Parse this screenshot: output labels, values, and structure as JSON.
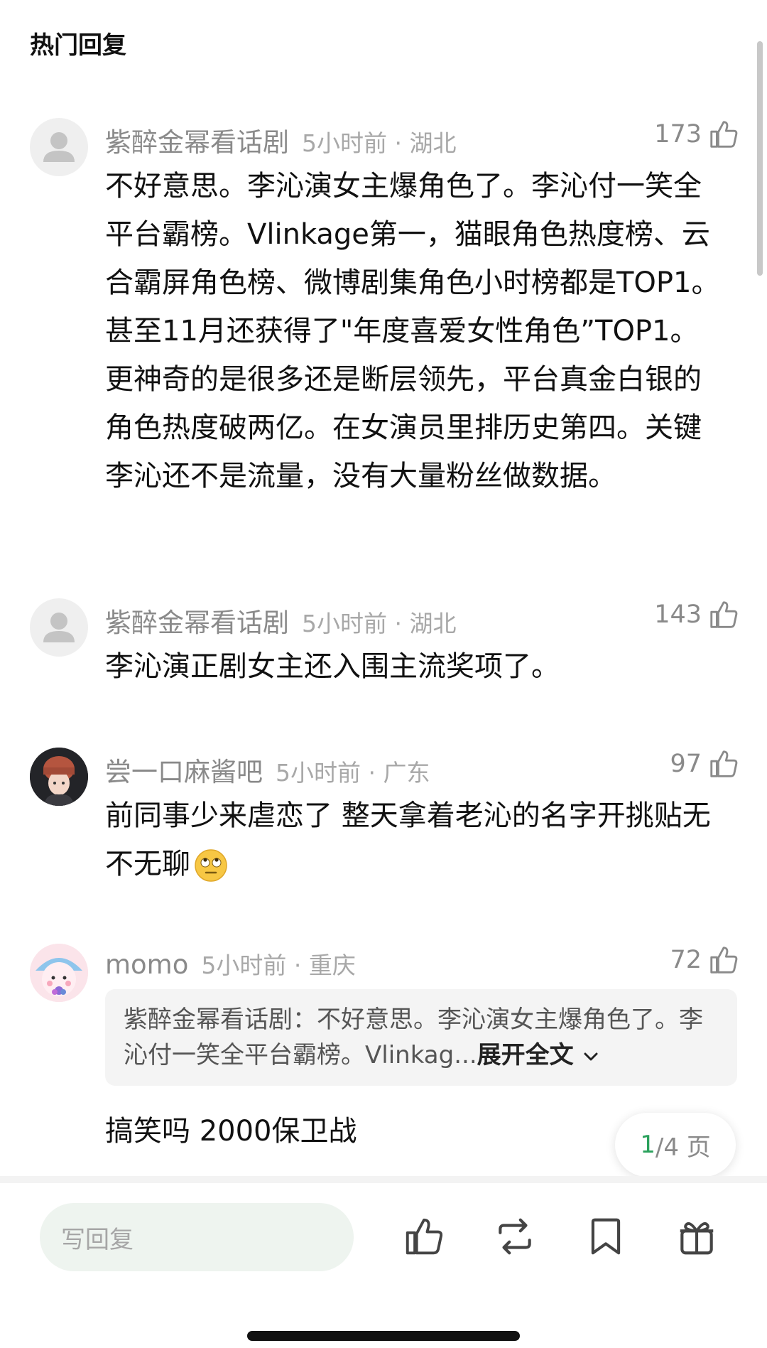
{
  "section": {
    "title": "热门回复"
  },
  "comments": [
    {
      "username": "紫醉金幂看话剧",
      "time_location": "5小时前 · 湖北",
      "likes": "173",
      "text": "不好意思。李沁演女主爆角色了。李沁付一笑全平台霸榜。Vlinkage第一，猫眼角色热度榜、云合霸屏角色榜、微博剧集角色小时榜都是TOP1。甚至11月还获得了\"年度喜爱女性角色”TOP1。更神奇的是很多还是断层领先，平台真金白银的角色热度破两亿。在女演员里排历史第四。关键李沁还不是流量，没有大量粉丝做数据。"
    },
    {
      "username": "紫醉金幂看话剧",
      "time_location": "5小时前 · 湖北",
      "likes": "143",
      "text": "李沁演正剧女主还入围主流奖项了。"
    },
    {
      "username": "尝一口麻酱吧",
      "time_location": "5小时前 · 广东",
      "likes": "97",
      "text": "前同事少来虐恋了 整天拿着老沁的名字开挑贴无不无聊"
    },
    {
      "username": "momo",
      "time_location": "5小时前 · 重庆",
      "likes": "72",
      "quote": "紫醉金幂看话剧：不好意思。李沁演女主爆角色了。李沁付一笑全平台霸榜。Vlinkag...",
      "quote_expand": "展开全文",
      "text": "搞笑吗 2000保卫战"
    }
  ],
  "pager": {
    "current": "1",
    "total_text": "/4 页"
  },
  "bottom_bar": {
    "reply_placeholder": "写回复"
  },
  "icons": {
    "like": "thumbs-up-icon",
    "repost": "repost-icon",
    "bookmark": "bookmark-icon",
    "gift": "gift-icon",
    "emoji": "eye-roll-emoji-icon"
  },
  "colors": {
    "accent": "#2aa15c",
    "muted": "#8a8a8a",
    "input_bg": "#eef4ef"
  }
}
